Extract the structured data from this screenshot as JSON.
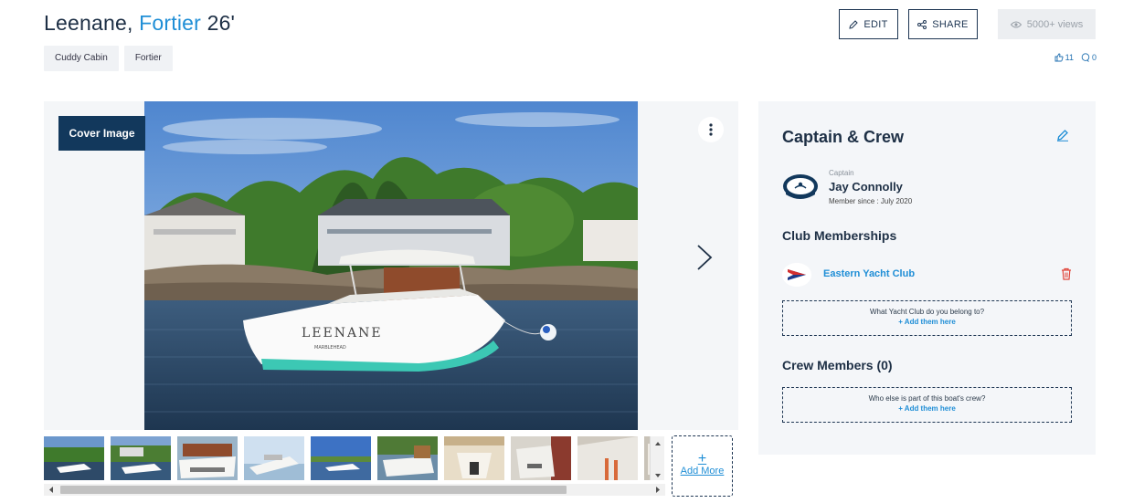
{
  "header": {
    "boat_name": "Leenane,",
    "make": "Fortier",
    "length": "26'",
    "tags": [
      "Cuddy Cabin",
      "Fortier"
    ],
    "edit_label": "EDIT",
    "share_label": "SHARE",
    "views_label": "5000+ views",
    "likes": "11",
    "comments": "0"
  },
  "gallery": {
    "cover_label": "Cover Image",
    "hull_name": "LEENANE",
    "hull_port": "MARBLEHEAD",
    "add_more_plus": "+",
    "add_more_label": "Add More"
  },
  "crew_panel": {
    "title": "Captain & Crew",
    "captain_role": "Captain",
    "captain_name": "Jay Connolly",
    "member_since": "Member since : July 2020",
    "clubs_title": "Club Memberships",
    "club_name": "Eastern Yacht Club",
    "club_prompt": "What Yacht Club do you belong to?",
    "club_add": "+ Add them here",
    "crew_title": "Crew Members (0)",
    "crew_prompt": "Who else is part of this boat's crew?",
    "crew_add": "+ Add them here"
  },
  "colors": {
    "accent": "#1f8ed6",
    "navy": "#1d3552",
    "badge": "#12385c",
    "delete": "#e0463c"
  }
}
